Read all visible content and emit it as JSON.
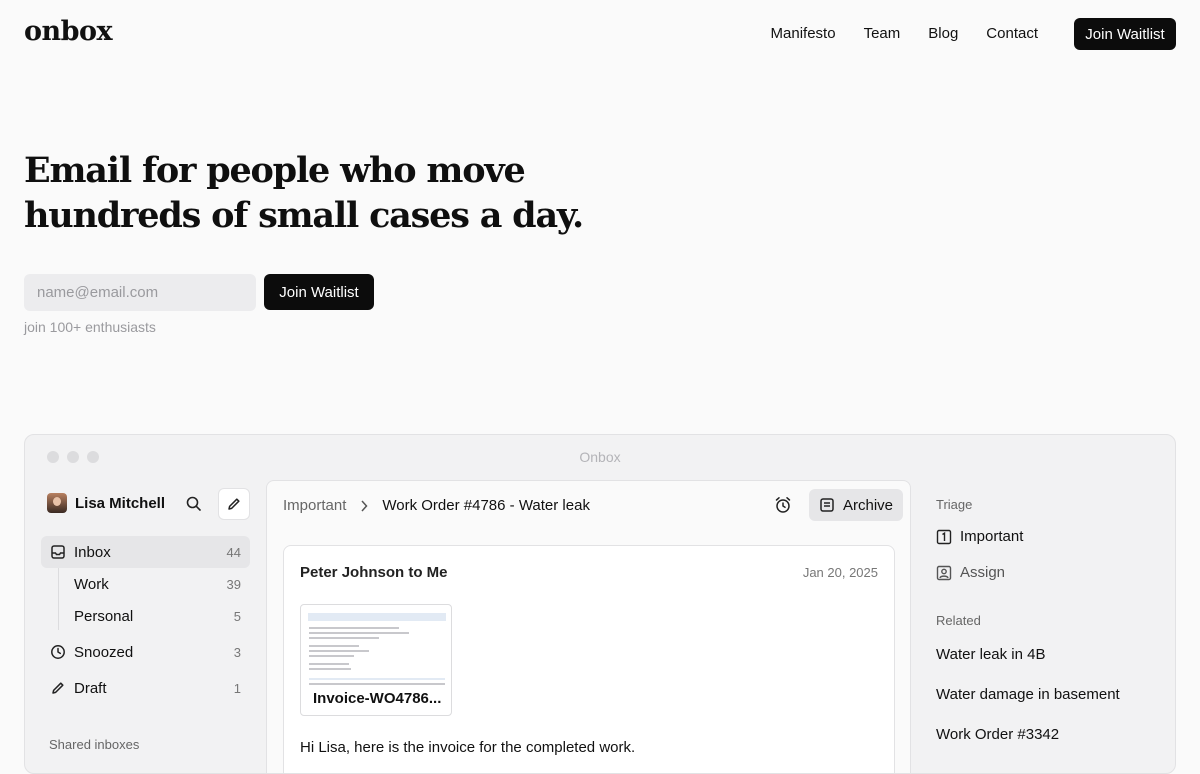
{
  "nav": {
    "logo": "onbox",
    "links": [
      "Manifesto",
      "Team",
      "Blog",
      "Contact"
    ],
    "cta": "Join Waitlist"
  },
  "hero": {
    "headline_line1": "Email for people who move",
    "headline_line2": "hundreds of small cases a day.",
    "email_placeholder": "name@email.com",
    "cta": "Join Waitlist",
    "subtext": "join 100+ enthusiasts"
  },
  "app": {
    "window_title": "Onbox",
    "user_name": "Lisa Mitchell",
    "sidebar": [
      {
        "label": "Inbox",
        "count": "44",
        "icon": "inbox-icon"
      },
      {
        "label": "Work",
        "count": "39"
      },
      {
        "label": "Personal",
        "count": "5"
      },
      {
        "label": "Snoozed",
        "count": "3",
        "icon": "clock-icon"
      },
      {
        "label": "Draft",
        "count": "1",
        "icon": "pencil-icon"
      }
    ],
    "shared_heading": "Shared inboxes",
    "breadcrumb": {
      "parent": "Important",
      "current": "Work Order #4786 - Water leak"
    },
    "archive_label": "Archive",
    "message": {
      "from": "Peter Johnson to Me",
      "date": "Jan 20, 2025",
      "attachment": "Invoice-WO4786...",
      "body": "Hi Lisa, here is the invoice for the completed work."
    },
    "triage": {
      "heading": "Triage",
      "important": "Important",
      "assign": "Assign"
    },
    "related": {
      "heading": "Related",
      "items": [
        "Water leak in 4B",
        "Water damage in basement",
        "Work Order #3342"
      ]
    }
  }
}
